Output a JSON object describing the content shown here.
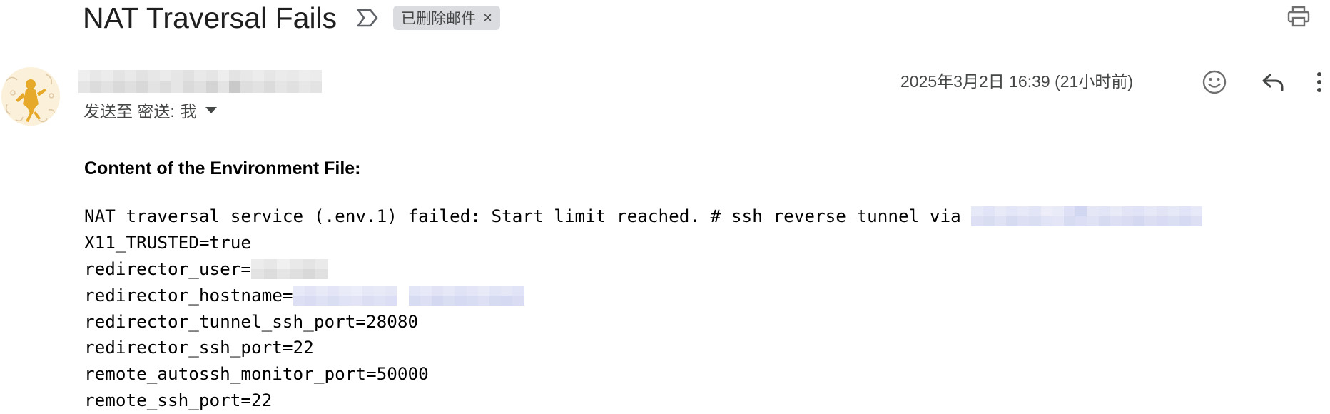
{
  "email": {
    "subject": "NAT Traversal Fails",
    "label_chip": "已删除邮件",
    "label_remove": "×",
    "recipients_prefix": "发送至 密送:",
    "recipients_name": "我",
    "timestamp": "2025年3月2日 16:39 (21小时前)"
  },
  "body": {
    "heading": "Content of the Environment File:",
    "lines": [
      "NAT traversal service (.env.1) failed: Start limit reached. # ssh reverse tunnel via ",
      "X11_TRUSTED=true",
      "redirector_user=",
      "redirector_hostname=",
      "redirector_tunnel_ssh_port=28080",
      "redirector_ssh_port=22",
      "remote_autossh_monitor_port=50000",
      "remote_ssh_port=22"
    ]
  },
  "icons": {
    "importance": "importance-marker-icon",
    "print": "print-icon",
    "open_in_new_window": "open-in-new-window-icon",
    "avatar": "avatar-illustration",
    "emoji": "emoji-reaction-icon",
    "reply": "reply-icon",
    "more": "more-vert-icon",
    "dropdown": "chevron-down-icon"
  },
  "colors": {
    "label_chip_bg": "#dadce0",
    "secondary_text": "#444746",
    "icon_gray": "#6f6f6f",
    "redaction_gray": "#e3e3e3",
    "redaction_blue": "#dfe2f7"
  }
}
